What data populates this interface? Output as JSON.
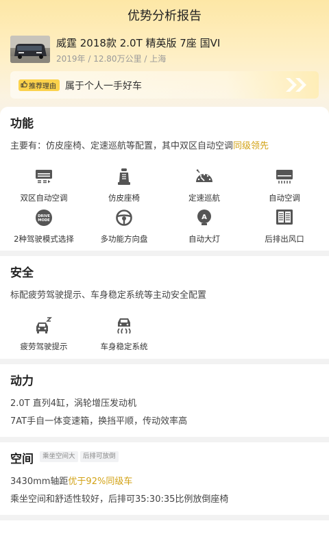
{
  "page_title": "优势分析报告",
  "car": {
    "name": "威霆 2018款 2.0T 精英版 7座 国VI",
    "meta": "2019年 / 12.80万公里 / 上海"
  },
  "reason": {
    "badge": "推荐理由",
    "text": "属于个人一手好车"
  },
  "sections": {
    "function": {
      "title": "功能",
      "desc_prefix": "主要有：仿皮座椅、定速巡航等配置，其中双区自动空调",
      "desc_highlight": "同级领先",
      "features": [
        {
          "label": "双区自动空调",
          "icon": "dual-zone-ac-icon"
        },
        {
          "label": "仿皮座椅",
          "icon": "leather-seat-icon"
        },
        {
          "label": "定速巡航",
          "icon": "cruise-control-icon"
        },
        {
          "label": "自动空调",
          "icon": "auto-ac-icon"
        },
        {
          "label": "2种驾驶模式选择",
          "icon": "drive-mode-icon"
        },
        {
          "label": "多功能方向盘",
          "icon": "steering-wheel-icon"
        },
        {
          "label": "自动大灯",
          "icon": "auto-headlight-icon"
        },
        {
          "label": "后排出风口",
          "icon": "rear-vent-icon"
        }
      ],
      "drive_mode_icon_text": [
        "DRIVE",
        "MODE"
      ],
      "headlight_icon_text": "A"
    },
    "safety": {
      "title": "安全",
      "desc": "标配疲劳驾驶提示、车身稳定系统等主动安全配置",
      "features": [
        {
          "label": "疲劳驾驶提示",
          "icon": "fatigue-warning-icon"
        },
        {
          "label": "车身稳定系统",
          "icon": "stability-control-icon"
        }
      ]
    },
    "power": {
      "title": "动力",
      "lines": [
        "2.0T 直列4缸，涡轮增压发动机",
        "7AT手自一体变速箱，换挡平顺，传动效率高"
      ]
    },
    "space": {
      "title": "空间",
      "tags": [
        "乘坐空间大",
        "后排可放倒"
      ],
      "line1_prefix": "3430mm轴距",
      "line1_highlight": "优于92%同级车",
      "line2": "乘坐空间和舒适性较好，后排可35:30:35比例放倒座椅"
    }
  },
  "colors": {
    "accent": "#d2a215",
    "badge": "#fbd24c",
    "icon": "#555555"
  }
}
